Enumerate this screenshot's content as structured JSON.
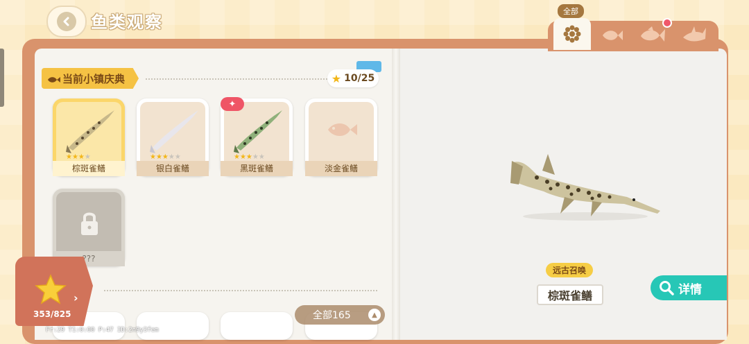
{
  "header": {
    "title": "鱼类观察",
    "back_icon": "back-arrow-icon"
  },
  "tabs": {
    "active_label": "全部",
    "items": [
      {
        "name": "all",
        "icon": "flower-icon",
        "active": true
      },
      {
        "name": "small-fish",
        "icon": "fish-icon",
        "active": false
      },
      {
        "name": "medium-fish",
        "icon": "fish-icon",
        "active": false,
        "notification": true
      },
      {
        "name": "large-fish",
        "icon": "shark-icon",
        "active": false
      }
    ]
  },
  "event": {
    "banner_label": "当前小镇庆典",
    "progress": "10/25"
  },
  "fish_cards": [
    {
      "name": "棕斑雀鳝",
      "stars": 3,
      "max_stars": 4,
      "selected": true
    },
    {
      "name": "银白雀鳝",
      "stars": 3,
      "max_stars": 5,
      "selected": false
    },
    {
      "name": "黑斑雀鳝",
      "stars": 3,
      "max_stars": 5,
      "selected": false,
      "badge": "new"
    },
    {
      "name": "淡金雀鳝",
      "stars": 0,
      "max_stars": 0,
      "selected": false,
      "undiscovered": true
    },
    {
      "name": "???",
      "locked": true
    }
  ],
  "collection": {
    "count": "353/825"
  },
  "all_count_label": "全部165",
  "debug_text": "Fr:29  T1:0:00  P:47  ID:2n9y3fem",
  "detail": {
    "tag": "远古召唤",
    "fish_name": "棕斑雀鳝",
    "button_label": "详情"
  },
  "colors": {
    "accent_teal": "#27c7b6",
    "banner_yellow": "#f5c244",
    "book_frame": "#d9936c"
  }
}
